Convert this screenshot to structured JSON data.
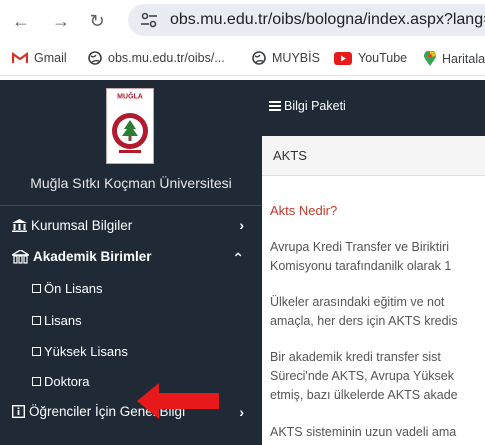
{
  "browser": {
    "back_icon": "arrow-left-icon",
    "forward_icon": "arrow-right-icon",
    "reload_icon": "reload-icon",
    "url": "obs.mu.edu.tr/oibs/bologna/index.aspx?lang=tr"
  },
  "bookmarks": [
    {
      "label": "Gmail",
      "icon": "gmail-icon"
    },
    {
      "label": "obs.mu.edu.tr/oibs/...",
      "icon": "globe-icon"
    },
    {
      "label": "MUYBİS",
      "icon": "globe-icon"
    },
    {
      "label": "YouTube",
      "icon": "youtube-icon"
    },
    {
      "label": "Haritala",
      "icon": "maps-icon"
    }
  ],
  "sidebar": {
    "logo_text": "MUĞLA",
    "university_name": "Muğla Sıtkı Koçman Üniversitesi",
    "items": [
      {
        "label": "Kurumsal Bilgiler",
        "icon": "institution-icon",
        "chevron": "›"
      },
      {
        "label": "Akademik Birimler",
        "icon": "academic-units-icon",
        "chevron": "⌃"
      }
    ],
    "sub_items": [
      "Ön Lisans",
      "Lisans",
      "Yüksek Lisans",
      "Doktora"
    ],
    "bottom_item": {
      "label": "Öğrenciler İçin Genel Bilgi",
      "icon": "info-icon",
      "chevron": "›"
    }
  },
  "topbar": {
    "title": "Bilgi Paketi"
  },
  "breadcrumb": {
    "text": "AKTS"
  },
  "content": {
    "title": "Akts Nedir?",
    "paragraphs": [
      [
        "Avrupa Kredi Transfer ve Biriktiri",
        "Komisyonu tarafındanilk olarak 1"
      ],
      [
        "Ülkeler arasındaki eğitim ve not",
        "amaçla, her ders için AKTS kredis"
      ],
      [
        "Bir akademik kredi transfer sist",
        "Süreci'nde AKTS, Avrupa Yüksek",
        "etmiş, bazı ülkelerde AKTS akade"
      ],
      [
        "AKTS sisteminin uzun vadeli ama"
      ]
    ]
  },
  "colors": {
    "sidebar_bg": "#1f2a36",
    "accent_red": "#e8191a",
    "title_red": "#c0392b"
  }
}
